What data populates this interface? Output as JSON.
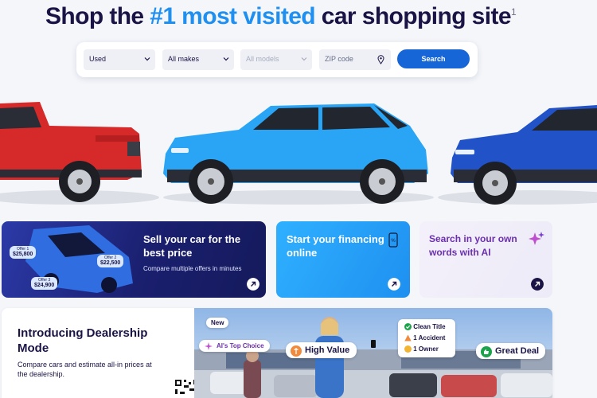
{
  "hero": {
    "title_prefix": "Shop the ",
    "title_accent": "#1 most visited",
    "title_suffix": " car shopping site",
    "footnote": "1"
  },
  "search": {
    "condition": "Used",
    "make": "All makes",
    "model": "All models",
    "zip_placeholder": "ZIP code",
    "button": "Search"
  },
  "cards": {
    "sell": {
      "title": "Sell your car for the best price",
      "subtitle": "Compare multiple offers in minutes",
      "offers": [
        {
          "label": "Offer 1",
          "amount": "$25,800"
        },
        {
          "label": "Offer 2",
          "amount": "$22,500"
        },
        {
          "label": "Offer 3",
          "amount": "$24,900"
        }
      ]
    },
    "financing": {
      "title": "Start your financing online"
    },
    "ai": {
      "title": "Search in your own words with AI"
    }
  },
  "banner": {
    "title": "Introducing Dealership Mode",
    "subtitle": "Compare cars and estimate all-in prices at the dealership.",
    "chips": {
      "new": "New",
      "ai_top_choice": "AI's Top Choice",
      "high_value": "High Value",
      "clean_title": "Clean Title",
      "one_accident": "1 Accident",
      "one_owner": "1 Owner",
      "great_deal": "Great Deal"
    }
  },
  "colors": {
    "navy": "#1a1446",
    "accent_blue": "#1f8ff0",
    "button_blue": "#1666d8",
    "ai_purple": "#6b2fb0"
  },
  "icons": [
    "chevron-down-icon",
    "location-pin-icon",
    "arrow-up-right-icon",
    "phone-percent-icon",
    "sparkle-icon",
    "qr-code-icon",
    "check-icon",
    "warning-icon",
    "info-icon",
    "thumbs-up-icon"
  ]
}
